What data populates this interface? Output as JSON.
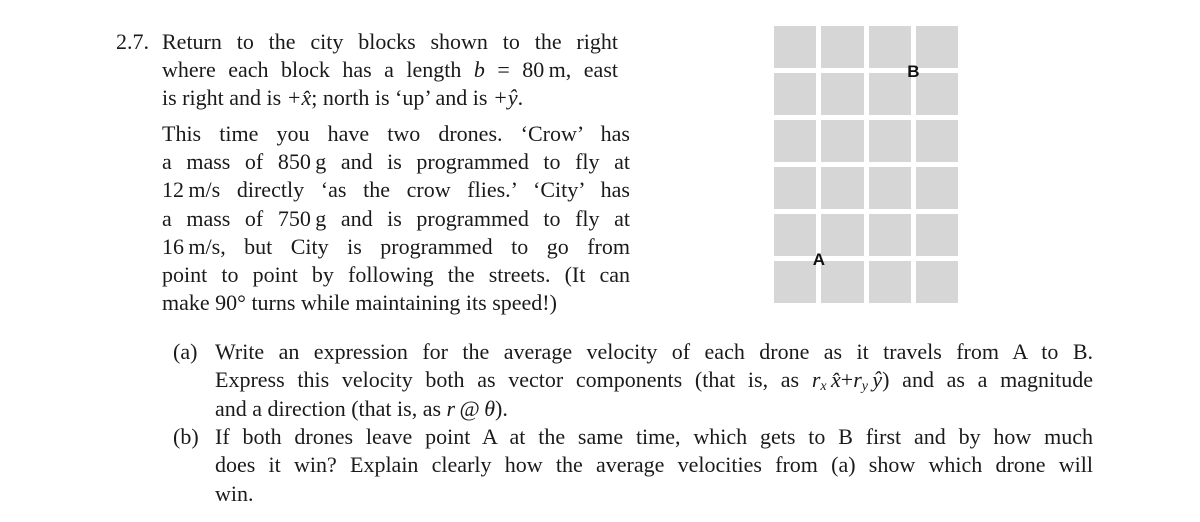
{
  "clipped_previous_line": "▔▔▔▔ ▔▔▔▔▔ ▔▔▔▔ ▔▔ ▔▔▔▔",
  "problem": {
    "number": "2.7.",
    "intro_lines": [
      "Return to the city blocks shown to the right",
      "where each block has a length",
      "is right and is"
    ],
    "intro_parts": {
      "block_var": "b",
      "equals": " = 80 m, east",
      "east_dir": "+x̂",
      "north_text": "; north is ‘up’ and is ",
      "north_dir": "+ŷ",
      "end": "."
    },
    "drones_lines": [
      "This time you have two drones. ‘Crow’ has",
      "a mass of 850 g and is programmed to fly at",
      "12 m/s directly ‘as the crow flies.’ ‘City’ has",
      "a mass of 750 g and is programmed to fly at",
      "16 m/s, but City is programmed to go from",
      "point to point by following the streets. (It can",
      "make 90° turns while maintaining its speed!)"
    ],
    "parts": [
      {
        "label": "(a)",
        "lines": [
          "Write an expression for the average velocity of each drone as it travels from A to B.",
          "Express this velocity both as vector components (that is, as",
          "and a direction (that is, as"
        ],
        "math": {
          "rx": "r",
          "rx_sub": "x",
          "xhat": " x̂",
          "plus": "+",
          "ry": "r",
          "ry_sub": "y",
          "yhat": " ŷ",
          "after_vec": ") and as a magnitude",
          "r": "r",
          "at": " @ ",
          "theta": "θ",
          "after_polar": ")."
        }
      },
      {
        "label": "(b)",
        "lines": [
          "If both drones leave point A at the same time, which gets to B first and by how much",
          "does it win? Explain clearly how the average velocities from (a) show which drone will",
          "win."
        ]
      }
    ]
  },
  "diagram": {
    "columns": 4,
    "rows": 6,
    "block_color": "#d6d6d6",
    "point_a": {
      "label": "A",
      "intersection_col": 1,
      "intersection_row": 5
    },
    "point_b": {
      "label": "B",
      "intersection_col": 3,
      "intersection_row": 1
    }
  }
}
